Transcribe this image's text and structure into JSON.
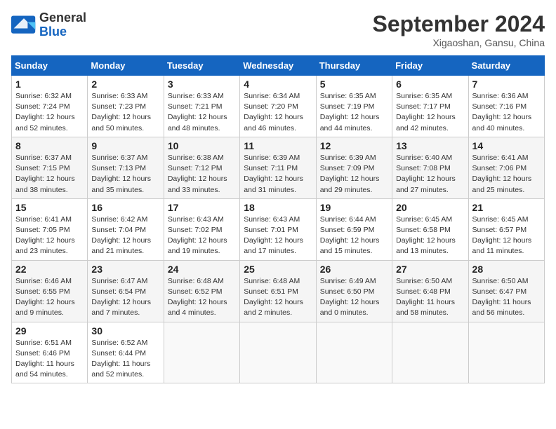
{
  "header": {
    "logo_line1": "General",
    "logo_line2": "Blue",
    "month": "September 2024",
    "location": "Xigaoshan, Gansu, China"
  },
  "days_of_week": [
    "Sunday",
    "Monday",
    "Tuesday",
    "Wednesday",
    "Thursday",
    "Friday",
    "Saturday"
  ],
  "weeks": [
    [
      {
        "num": "1",
        "info": "Sunrise: 6:32 AM\nSunset: 7:24 PM\nDaylight: 12 hours\nand 52 minutes."
      },
      {
        "num": "2",
        "info": "Sunrise: 6:33 AM\nSunset: 7:23 PM\nDaylight: 12 hours\nand 50 minutes."
      },
      {
        "num": "3",
        "info": "Sunrise: 6:33 AM\nSunset: 7:21 PM\nDaylight: 12 hours\nand 48 minutes."
      },
      {
        "num": "4",
        "info": "Sunrise: 6:34 AM\nSunset: 7:20 PM\nDaylight: 12 hours\nand 46 minutes."
      },
      {
        "num": "5",
        "info": "Sunrise: 6:35 AM\nSunset: 7:19 PM\nDaylight: 12 hours\nand 44 minutes."
      },
      {
        "num": "6",
        "info": "Sunrise: 6:35 AM\nSunset: 7:17 PM\nDaylight: 12 hours\nand 42 minutes."
      },
      {
        "num": "7",
        "info": "Sunrise: 6:36 AM\nSunset: 7:16 PM\nDaylight: 12 hours\nand 40 minutes."
      }
    ],
    [
      {
        "num": "8",
        "info": "Sunrise: 6:37 AM\nSunset: 7:15 PM\nDaylight: 12 hours\nand 38 minutes."
      },
      {
        "num": "9",
        "info": "Sunrise: 6:37 AM\nSunset: 7:13 PM\nDaylight: 12 hours\nand 35 minutes."
      },
      {
        "num": "10",
        "info": "Sunrise: 6:38 AM\nSunset: 7:12 PM\nDaylight: 12 hours\nand 33 minutes."
      },
      {
        "num": "11",
        "info": "Sunrise: 6:39 AM\nSunset: 7:11 PM\nDaylight: 12 hours\nand 31 minutes."
      },
      {
        "num": "12",
        "info": "Sunrise: 6:39 AM\nSunset: 7:09 PM\nDaylight: 12 hours\nand 29 minutes."
      },
      {
        "num": "13",
        "info": "Sunrise: 6:40 AM\nSunset: 7:08 PM\nDaylight: 12 hours\nand 27 minutes."
      },
      {
        "num": "14",
        "info": "Sunrise: 6:41 AM\nSunset: 7:06 PM\nDaylight: 12 hours\nand 25 minutes."
      }
    ],
    [
      {
        "num": "15",
        "info": "Sunrise: 6:41 AM\nSunset: 7:05 PM\nDaylight: 12 hours\nand 23 minutes."
      },
      {
        "num": "16",
        "info": "Sunrise: 6:42 AM\nSunset: 7:04 PM\nDaylight: 12 hours\nand 21 minutes."
      },
      {
        "num": "17",
        "info": "Sunrise: 6:43 AM\nSunset: 7:02 PM\nDaylight: 12 hours\nand 19 minutes."
      },
      {
        "num": "18",
        "info": "Sunrise: 6:43 AM\nSunset: 7:01 PM\nDaylight: 12 hours\nand 17 minutes."
      },
      {
        "num": "19",
        "info": "Sunrise: 6:44 AM\nSunset: 6:59 PM\nDaylight: 12 hours\nand 15 minutes."
      },
      {
        "num": "20",
        "info": "Sunrise: 6:45 AM\nSunset: 6:58 PM\nDaylight: 12 hours\nand 13 minutes."
      },
      {
        "num": "21",
        "info": "Sunrise: 6:45 AM\nSunset: 6:57 PM\nDaylight: 12 hours\nand 11 minutes."
      }
    ],
    [
      {
        "num": "22",
        "info": "Sunrise: 6:46 AM\nSunset: 6:55 PM\nDaylight: 12 hours\nand 9 minutes."
      },
      {
        "num": "23",
        "info": "Sunrise: 6:47 AM\nSunset: 6:54 PM\nDaylight: 12 hours\nand 7 minutes."
      },
      {
        "num": "24",
        "info": "Sunrise: 6:48 AM\nSunset: 6:52 PM\nDaylight: 12 hours\nand 4 minutes."
      },
      {
        "num": "25",
        "info": "Sunrise: 6:48 AM\nSunset: 6:51 PM\nDaylight: 12 hours\nand 2 minutes."
      },
      {
        "num": "26",
        "info": "Sunrise: 6:49 AM\nSunset: 6:50 PM\nDaylight: 12 hours\nand 0 minutes."
      },
      {
        "num": "27",
        "info": "Sunrise: 6:50 AM\nSunset: 6:48 PM\nDaylight: 11 hours\nand 58 minutes."
      },
      {
        "num": "28",
        "info": "Sunrise: 6:50 AM\nSunset: 6:47 PM\nDaylight: 11 hours\nand 56 minutes."
      }
    ],
    [
      {
        "num": "29",
        "info": "Sunrise: 6:51 AM\nSunset: 6:46 PM\nDaylight: 11 hours\nand 54 minutes."
      },
      {
        "num": "30",
        "info": "Sunrise: 6:52 AM\nSunset: 6:44 PM\nDaylight: 11 hours\nand 52 minutes."
      },
      {
        "num": "",
        "info": ""
      },
      {
        "num": "",
        "info": ""
      },
      {
        "num": "",
        "info": ""
      },
      {
        "num": "",
        "info": ""
      },
      {
        "num": "",
        "info": ""
      }
    ]
  ]
}
